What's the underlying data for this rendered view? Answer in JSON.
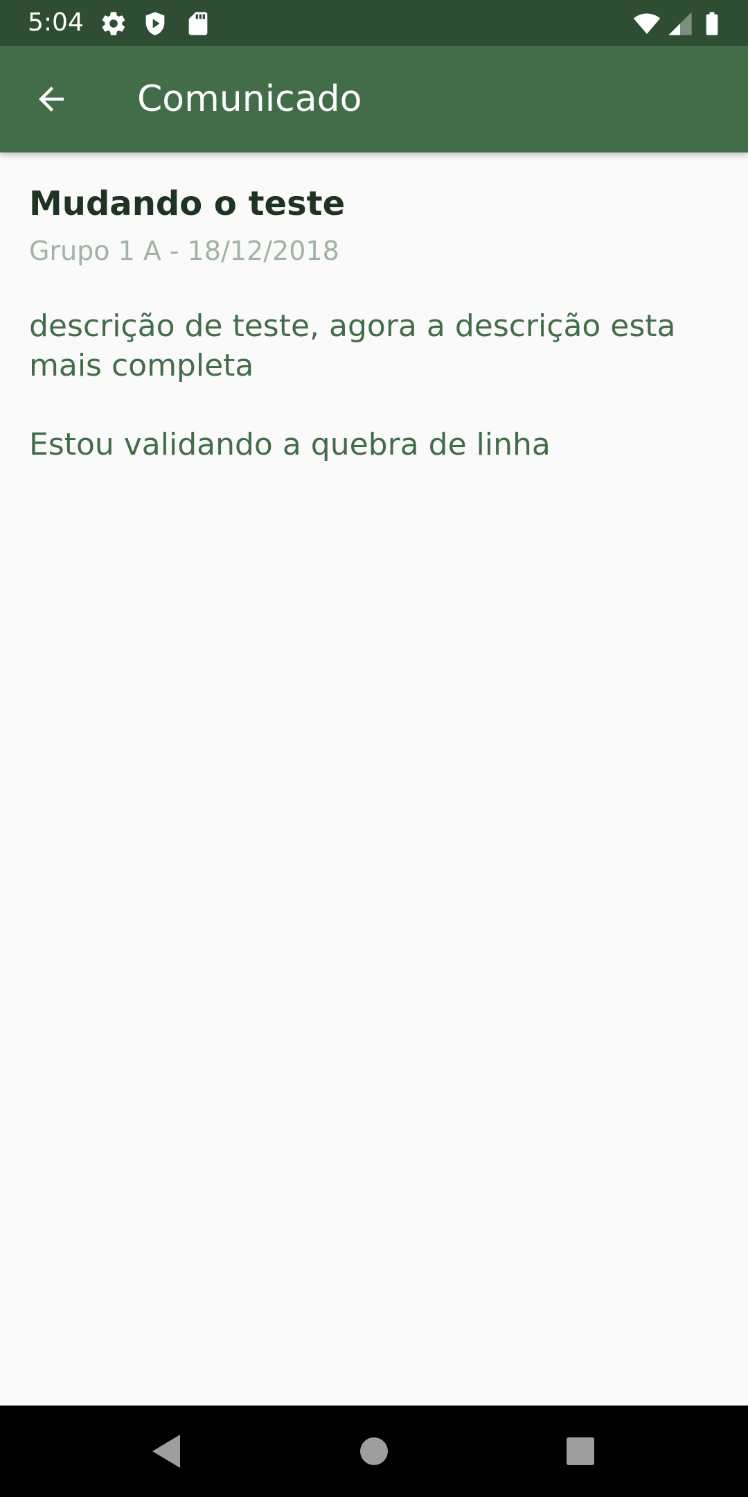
{
  "status_bar": {
    "time": "5:04",
    "icons_left": [
      "gear-icon",
      "shield-icon",
      "sd-card-icon"
    ],
    "icons_right": [
      "wifi-icon",
      "signal-icon",
      "battery-icon"
    ]
  },
  "app_bar": {
    "title": "Comunicado",
    "back_icon": "arrow-back-icon"
  },
  "notice": {
    "title": "Mudando o teste",
    "meta": "Grupo 1 A - 18/12/2018",
    "body": "descrição de teste, agora a descrição esta mais completa\n\nEstou validando a quebra de linha"
  },
  "colors": {
    "status_bar": "#2f4d33",
    "app_bar": "#426d48",
    "title_text": "#1e3322",
    "meta_text": "#a1b3a4",
    "body_text": "#426d48",
    "background": "#fafafa"
  },
  "nav_bar": {
    "buttons": [
      "back-triangle-icon",
      "home-circle-icon",
      "recents-square-icon"
    ]
  }
}
